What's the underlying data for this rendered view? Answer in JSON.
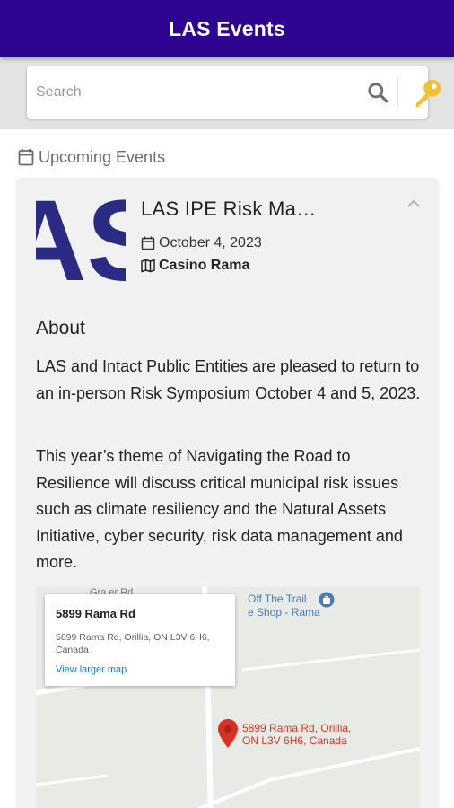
{
  "app": {
    "title": "LAS Events"
  },
  "search": {
    "placeholder": "Search",
    "search_icon": "search-icon",
    "key_icon": "key-icon",
    "key_color": "#f2c12e"
  },
  "section": {
    "label": "Upcoming Events",
    "icon": "calendar-icon"
  },
  "event": {
    "title": "LAS IPE Risk Ma…",
    "date": "October 4, 2023",
    "venue": "Casino Rama",
    "logo_text": "AS",
    "logo_color": "#2b2a84",
    "about_heading": "About",
    "about_p1": "LAS and Intact Public Entities are pleased to return to an in-person Risk Symposium October 4 and 5, 2023.",
    "about_p2": "This year’s theme of Navigating the Road to Resilience will discuss critical municipal risk issues such as climate resiliency and the Natural Assets Initiative, cyber security, risk data management and more."
  },
  "map": {
    "info_title": "5899 Rama Rd",
    "info_address": "5899 Rama Rd, Orillia, ON L3V 6H6, Canada",
    "info_link": "View larger map",
    "poi_label": "Off The Trail\ne Shop - Rama",
    "road_label": "Gra        er Rd",
    "pin_label": "5899 Rama Rd, Orillia,\nON L3V 6H6, Canada"
  },
  "colors": {
    "appbar": "#2e0590",
    "pin": "#d93025",
    "link": "#1a73e8"
  }
}
